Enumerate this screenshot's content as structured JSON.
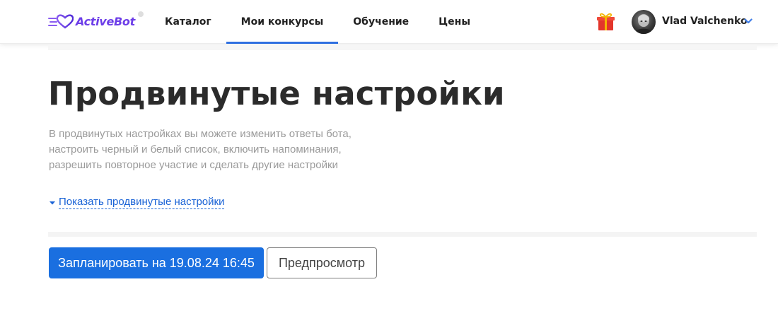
{
  "header": {
    "logo_text": "ActiveBot",
    "nav": [
      {
        "label": "Каталог",
        "active": false
      },
      {
        "label": "Мои конкурсы",
        "active": true
      },
      {
        "label": "Обучение",
        "active": false
      },
      {
        "label": "Цены",
        "active": false
      }
    ],
    "user_name": "Vlad Valchenko",
    "icons": {
      "gift": "gift-icon",
      "chevron": "chevron-down-icon"
    }
  },
  "main": {
    "title": "Продвинутые настройки",
    "description": [
      "В продвинутых настройках вы можете изменить ответы бота,",
      "настроить черный и белый список, включить напоминания,",
      "разрешить повторное участие и сделать другие настройки"
    ],
    "toggle_label": "Показать продвинутые настройки",
    "schedule_button": "Запланировать на 19.08.24 16:45",
    "preview_button": "Предпросмотр"
  },
  "colors": {
    "accent": "#1a6fe0",
    "brand": "#6d3ee8",
    "nav_underline": "#2f6fe0",
    "link": "#1a63d6",
    "gift_red": "#e3352b",
    "gift_ribbon": "#f4b400"
  }
}
